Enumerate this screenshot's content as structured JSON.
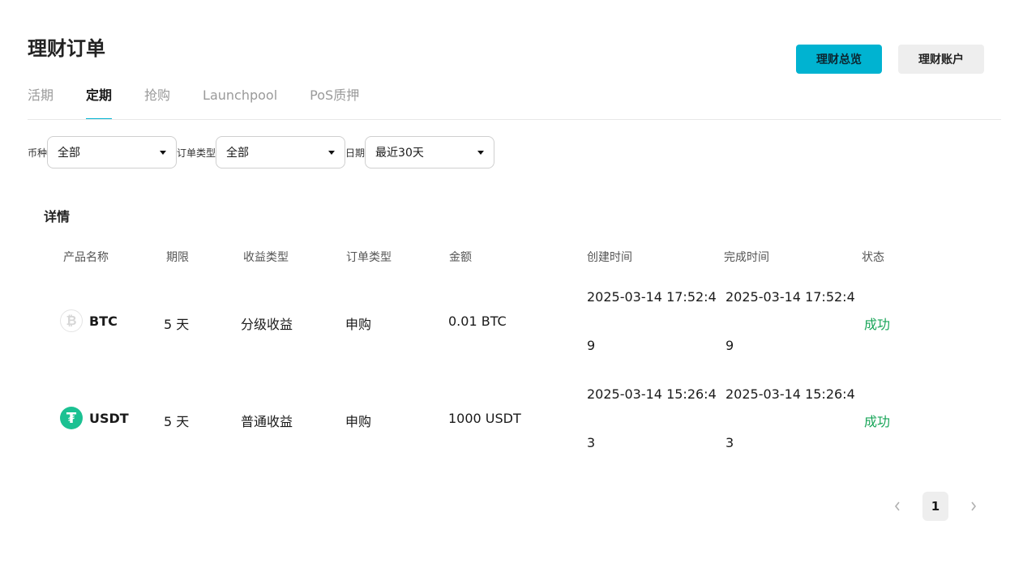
{
  "header": {
    "title": "理财订单",
    "overview_button": "理财总览",
    "account_button": "理财账户"
  },
  "tabs": [
    {
      "label": "活期",
      "active": false
    },
    {
      "label": "定期",
      "active": true
    },
    {
      "label": "抢购",
      "active": false
    },
    {
      "label": "Launchpool",
      "active": false
    },
    {
      "label": "PoS质押",
      "active": false
    }
  ],
  "filters": {
    "coin": {
      "label": "币种",
      "value": "全部"
    },
    "order_type": {
      "label": "订单类型",
      "value": "全部"
    },
    "date": {
      "label": "日期",
      "value": "最近30天"
    }
  },
  "details": {
    "title": "详情",
    "columns": [
      "产品名称",
      "期限",
      "收益类型",
      "订单类型",
      "金额",
      "创建时间",
      "完成时间",
      "状态"
    ],
    "rows": [
      {
        "icon": "bitcoin-icon",
        "product": "BTC",
        "term": "5 天",
        "yield_type": "分级收益",
        "order_type": "申购",
        "amount": "0.01 BTC",
        "created_line1": "2025-03-14 17:52:4",
        "created_line2": "9",
        "completed_line1": "2025-03-14 17:52:4",
        "completed_line2": "9",
        "status": "成功"
      },
      {
        "icon": "tether-icon",
        "product": "USDT",
        "term": "5 天",
        "yield_type": "普通收益",
        "order_type": "申购",
        "amount": "1000 USDT",
        "created_line1": "2025-03-14 15:26:4",
        "created_line2": "3",
        "completed_line1": "2025-03-14 15:26:4",
        "completed_line2": "3",
        "status": "成功"
      }
    ]
  },
  "pagination": {
    "current_page": "1",
    "prev_icon": "chevron-left-icon",
    "next_icon": "chevron-right-icon"
  },
  "colors": {
    "accent": "#00b3d1",
    "success": "#18a558",
    "usdt_green": "#1bc192"
  }
}
